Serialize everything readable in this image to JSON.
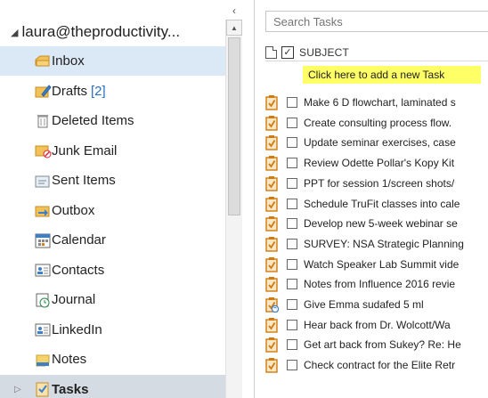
{
  "account": {
    "name": "laura@theproductivity..."
  },
  "folders": [
    {
      "label": "Inbox",
      "count": "",
      "icon": "inbox-icon"
    },
    {
      "label": "Drafts",
      "count": "[2]",
      "icon": "drafts-icon"
    },
    {
      "label": "Deleted Items",
      "count": "",
      "icon": "deleted-items-icon"
    },
    {
      "label": "Junk Email",
      "count": "",
      "icon": "junk-email-icon"
    },
    {
      "label": "Sent Items",
      "count": "",
      "icon": "sent-items-icon"
    },
    {
      "label": "Outbox",
      "count": "",
      "icon": "outbox-icon"
    },
    {
      "label": "Calendar",
      "count": "",
      "icon": "calendar-icon"
    },
    {
      "label": "Contacts",
      "count": "",
      "icon": "contacts-icon"
    },
    {
      "label": "Journal",
      "count": "",
      "icon": "journal-icon"
    },
    {
      "label": "LinkedIn",
      "count": "",
      "icon": "linkedin-contacts-icon"
    },
    {
      "label": "Notes",
      "count": "",
      "icon": "notes-icon"
    },
    {
      "label": "Tasks",
      "count": "",
      "icon": "tasks-icon"
    }
  ],
  "search": {
    "placeholder": "Search Tasks"
  },
  "columns": {
    "subject": "SUBJECT"
  },
  "new_task": {
    "label": "Click here to add a new Task"
  },
  "tasks": [
    {
      "subject": "Make 6 D flowchart, laminated s",
      "icon": "task-icon"
    },
    {
      "subject": "Create consulting process flow.",
      "icon": "task-icon"
    },
    {
      "subject": "Update seminar exercises, case",
      "icon": "task-icon"
    },
    {
      "subject": "Review Odette Pollar's Kopy Kit",
      "icon": "task-icon"
    },
    {
      "subject": "PPT for session 1/screen shots/",
      "icon": "task-icon"
    },
    {
      "subject": "Schedule TruFit classes into cale",
      "icon": "task-icon"
    },
    {
      "subject": "Develop new 5-week webinar se",
      "icon": "task-icon"
    },
    {
      "subject": "SURVEY: NSA Strategic Planning",
      "icon": "task-icon"
    },
    {
      "subject": "Watch Speaker Lab Summit vide",
      "icon": "task-icon"
    },
    {
      "subject": "Notes from Influence 2016 revie",
      "icon": "task-icon"
    },
    {
      "subject": "Give Emma sudafed 5 ml",
      "icon": "recurring-task-icon"
    },
    {
      "subject": "Hear back from Dr. Wolcott/Wa",
      "icon": "task-icon"
    },
    {
      "subject": "Get art back from Sukey? Re: He",
      "icon": "task-icon"
    },
    {
      "subject": "Check contract for the Elite Retr",
      "icon": "task-icon"
    }
  ],
  "colors": {
    "selected": "#dbe8f6",
    "active": "#d5dbe3",
    "highlight": "#ffff66",
    "accent": "#2a6fbf",
    "task_orange": "#e07b1a"
  }
}
